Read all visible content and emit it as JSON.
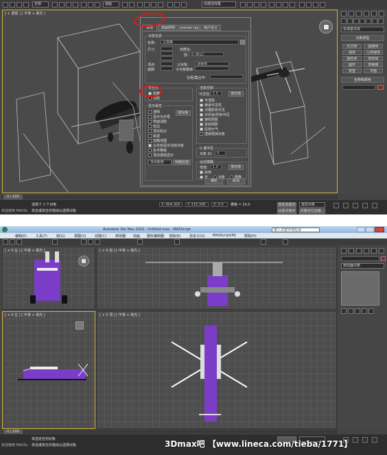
{
  "top": {
    "toolbar": {
      "selection_filter": "全部",
      "ref_coord": "视图",
      "named_selection": "创建选择集"
    },
    "viewport": {
      "label": "[ + 透视 ] [ 平滑 + 高光 ]"
    },
    "command_panel": {
      "dropdown": "标准基本体",
      "object_type_title": "对象类型",
      "object_buttons": [
        "长方体",
        "圆锥体",
        "球体",
        "几何球体",
        "圆柱体",
        "管状体",
        "圆环",
        "四棱锥",
        "茶壶",
        "平面"
      ],
      "name_color_title": "名称和颜色"
    },
    "dialog": {
      "tabs": [
        "常规",
        "高级照明",
        "mental ray",
        "用户定义"
      ],
      "info": {
        "title": "对象信息",
        "name_label": "名称:",
        "name_value": "主旋翼",
        "dims_label": "尺寸:",
        "material_label": "材质名:",
        "layer_label": "层:",
        "layer_value": "0 (默认)",
        "vertices_label": "顶点:",
        "faces_label": "面数:",
        "parent_label": "父对象:",
        "parent_value": "场景根",
        "children_label": "子对象数目:",
        "group_label": "在组/集合中:"
      },
      "interactivity": {
        "title": "交互性",
        "items": [
          "隐藏",
          "冻结"
        ]
      },
      "display": {
        "title": "显示属性",
        "by_object_btn": "按对象",
        "items": [
          "透明",
          "显示为外框",
          "背面消隐",
          "仅边",
          "顶点标记",
          "轨迹",
          "忽略范围",
          "以灰色显示冻结对象",
          "永不降级",
          "顶点通道显示"
        ],
        "channel_value": "顶点颜色",
        "shaded_btn": "明暗处理"
      },
      "render": {
        "title": "渲染控制",
        "visibility_label": "可见性:",
        "visibility_value": "1.0",
        "by_object_btn": "按对象",
        "items": [
          "可渲染",
          "继承可见性",
          "对摄影机可见",
          "对反射/折射可见",
          "接收阴影",
          "投射阴影",
          "应用大气",
          "渲染阻挡对象"
        ]
      },
      "gbuffer": {
        "title": "G 缓冲区",
        "label": "对象 ID:",
        "value": "0"
      },
      "motion_blur": {
        "title": "运动模糊",
        "mult_label": "倍增:",
        "mult_value": "1.0",
        "by_object_btn": "按对象",
        "enabled": "启用",
        "opts": [
          "无",
          "对象",
          "图像"
        ]
      },
      "ok": "确定",
      "cancel": "取消"
    },
    "status": {
      "selection": "选择了 1 个对象",
      "hint": "单击或单击并拖动以选择对象",
      "welcome": "欢迎使用 MAXSc",
      "timeline": "0 / 100",
      "x": "X: 604.300",
      "y": "Y: 215.306",
      "z": "Z: 0.0",
      "grid": "栅格 = 10.0",
      "autokey": "自动关键点",
      "setkey": "设置关键点",
      "key_filter": "选定对象",
      "key_filters_btn": "关键点过滤器..."
    }
  },
  "bottom": {
    "titlebar": {
      "title": "Autodesk 3ds Max 2010 - Untitled.max - MAXScript",
      "search_placeholder": "键入关键字或短语"
    },
    "menus": [
      "编辑(E)",
      "工具(T)",
      "组(G)",
      "视图(V)",
      "创建(C)",
      "修改器",
      "动画",
      "图形编辑器",
      "渲染(R)",
      "自定义(U)",
      "MAXScript(M)",
      "帮助(H)"
    ],
    "viewports": {
      "top_left": "[ + 0 左 ] [ 平滑 + 高光 ]",
      "top_right": "[ + 0 前 ] [ 平滑 + 高光 ]",
      "bottom_left": "[ + 0 左 ] [ 平滑 + 高光 ]",
      "bottom_right": "[ + 0 顶 ] [ 平滑 + 高光 ]"
    },
    "command_panel": {
      "dropdown": "修改器列表"
    },
    "status": {
      "selection": "未选定任何对象",
      "hint": "单击或单击并拖动以选择对象",
      "welcome": "欢迎使用 MAXSc",
      "timeline": "0 / 100"
    },
    "watermark": "3Dmax吧 【www.lineca.com/tieba/1771】"
  }
}
